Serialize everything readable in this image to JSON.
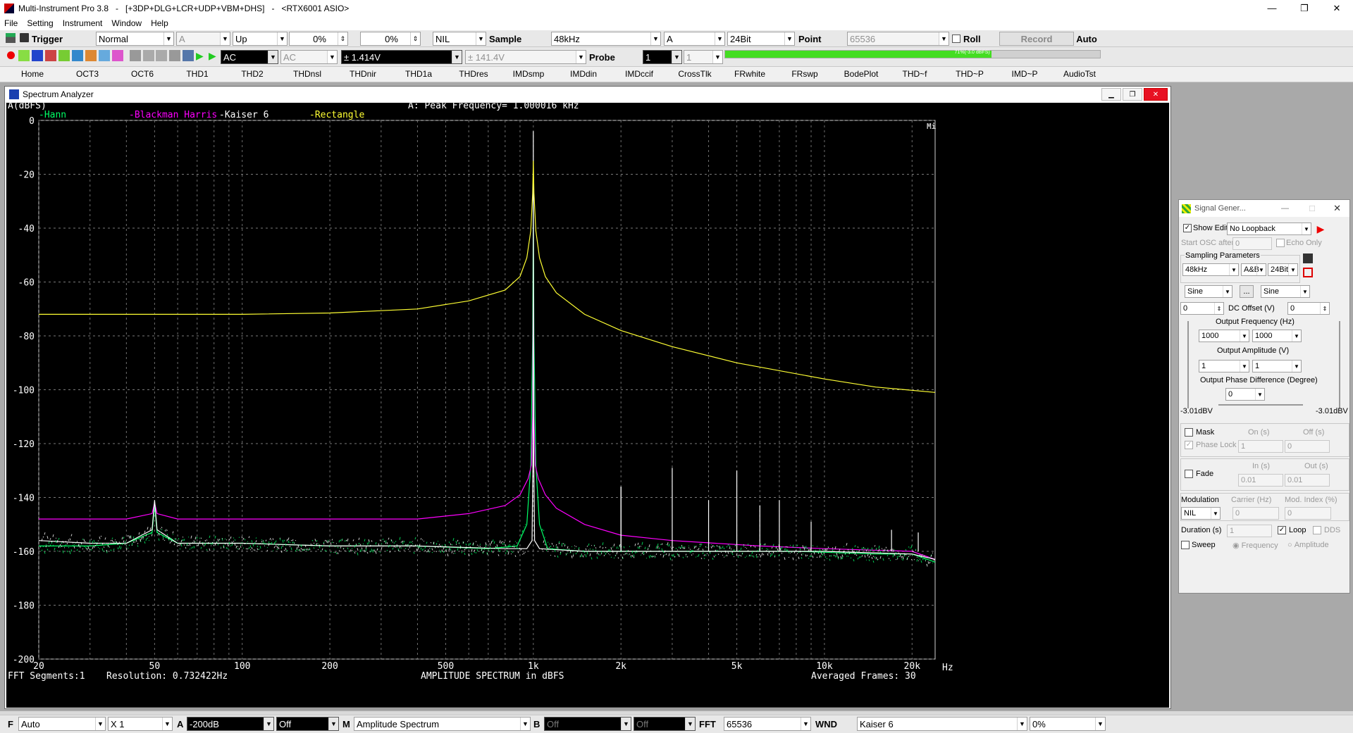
{
  "window": {
    "title": "Multi-Instrument Pro 3.8   -   [+3DP+DLG+LCR+UDP+VBM+DHS]   -   <RTX6001 ASIO>",
    "controls": [
      "—",
      "❐",
      "✕"
    ]
  },
  "menu": [
    "File",
    "Setting",
    "Instrument",
    "Window",
    "Help"
  ],
  "toolbar1": {
    "trigger_label": "Trigger",
    "trigger_mode": "Normal",
    "trigger_channel": "A",
    "trigger_edge": "Up",
    "trigger_level": "0%",
    "pretrigger": "0%",
    "channel_mode": "NIL",
    "sample_label": "Sample",
    "sample_rate": "48kHz",
    "channel": "A",
    "bit_depth": "24Bit",
    "point_label": "Point",
    "points": "65536",
    "roll_label": "Roll",
    "record_label": "Record",
    "auto_label": "Auto"
  },
  "toolbar2": {
    "coupling_a": "AC",
    "coupling_b": "AC",
    "range_a": "± 1.414V",
    "range_b": "± 141.4V",
    "probe_label": "Probe",
    "probe_a": "1",
    "probe_b": "1",
    "level_meter": "71%(-3.0 dBFS)",
    "level_fraction": 0.71
  },
  "tabs": [
    "Home",
    "OCT3",
    "OCT6",
    "THD1",
    "THD2",
    "THDnsl",
    "THDnir",
    "THD1a",
    "THDres",
    "IMDsmp",
    "IMDdin",
    "IMDccif",
    "CrossTlk",
    "FRwhite",
    "FRswp",
    "BodePlot",
    "THD~f",
    "THD~P",
    "IMD~P",
    "AudioTst"
  ],
  "analyzer": {
    "title": "Spectrum Analyzer",
    "ylabel": "A(dBFS)",
    "peak_readout": "A: Peak Frequency= 1.000016 kHz",
    "logo": "Mi",
    "footer_left": "FFT Segments:1",
    "footer_resolution": "Resolution: 0.732422Hz",
    "footer_center": "AMPLITUDE SPECTRUM in dBFS",
    "footer_right": "Averaged Frames: 30",
    "x_unit": "Hz"
  },
  "chart_data": {
    "type": "line",
    "title": "A: Peak Frequency= 1.000016 kHz",
    "xlabel": "AMPLITUDE SPECTRUM in dBFS",
    "ylabel": "A(dBFS)",
    "xscale": "log",
    "xlim": [
      20,
      24000
    ],
    "ylim": [
      -200,
      0
    ],
    "yticks": [
      0,
      -20,
      -40,
      -60,
      -80,
      -100,
      -120,
      -140,
      -160,
      -180,
      -200
    ],
    "xticks": [
      {
        "v": 20,
        "label": "20"
      },
      {
        "v": 50,
        "label": "50"
      },
      {
        "v": 100,
        "label": "100"
      },
      {
        "v": 200,
        "label": "200"
      },
      {
        "v": 500,
        "label": "500"
      },
      {
        "v": 1000,
        "label": "1k"
      },
      {
        "v": 2000,
        "label": "2k"
      },
      {
        "v": 5000,
        "label": "5k"
      },
      {
        "v": 10000,
        "label": "10k"
      },
      {
        "v": 20000,
        "label": "20k"
      }
    ],
    "grid": true,
    "legend_placement": "top",
    "series": [
      {
        "name": "Hann",
        "color": "#00ff66",
        "x": [
          20,
          30,
          40,
          49,
          50,
          51,
          60,
          100,
          200,
          400,
          700,
          880,
          950,
          980,
          995,
          1000,
          1005,
          1020,
          1050,
          1120,
          1500,
          3000,
          8000,
          15000,
          20000,
          24000
        ],
        "y": [
          -158,
          -158,
          -157,
          -153,
          -143,
          -153,
          -157,
          -157,
          -158,
          -158,
          -159,
          -158,
          -150,
          -128,
          -80,
          -32,
          -80,
          -128,
          -150,
          -159,
          -160,
          -160,
          -160,
          -161,
          -161,
          -164
        ]
      },
      {
        "name": "Blackman Harris",
        "color": "#ff00ff",
        "x": [
          20,
          30,
          40,
          49,
          50,
          51,
          60,
          100,
          200,
          400,
          600,
          800,
          900,
          960,
          985,
          995,
          1000,
          1005,
          1015,
          1040,
          1100,
          1200,
          1500,
          2000,
          3000,
          6000,
          10000,
          20000,
          24000
        ],
        "y": [
          -148,
          -148,
          -148,
          -146,
          -142,
          -146,
          -148,
          -148,
          -148,
          -148,
          -146,
          -143,
          -139,
          -133,
          -128,
          -110,
          -55,
          -110,
          -128,
          -133,
          -139,
          -144,
          -150,
          -154,
          -156,
          -158,
          -159,
          -160,
          -163
        ]
      },
      {
        "name": "Kaiser 6",
        "color": "#ffffff",
        "x": [
          20,
          30,
          40,
          49,
          50,
          51,
          60,
          100,
          200,
          400,
          800,
          950,
          990,
          998,
          1000,
          1002,
          1010,
          1050,
          1500,
          1999,
          2000,
          2001,
          3000,
          5000,
          10000,
          20000,
          24000
        ],
        "y": [
          -156,
          -157,
          -157,
          -152,
          -141,
          -152,
          -157,
          -157,
          -158,
          -158,
          -159,
          -159,
          -156,
          -120,
          -4,
          -120,
          -156,
          -159,
          -160,
          -160,
          -136,
          -160,
          -160,
          -160,
          -160,
          -161,
          -163
        ]
      },
      {
        "name": "Rectangle",
        "color": "#ffff33",
        "x": [
          20,
          50,
          100,
          200,
          400,
          600,
          800,
          900,
          950,
          980,
          995,
          1000,
          1005,
          1020,
          1050,
          1100,
          1200,
          1500,
          2000,
          3000,
          5000,
          10000,
          15000,
          24000
        ],
        "y": [
          -72,
          -72,
          -72,
          -71.5,
          -70,
          -67,
          -63,
          -58,
          -51,
          -41,
          -27,
          -15,
          -27,
          -41,
          -51,
          -58,
          -64,
          -72,
          -78,
          -84,
          -90,
          -96,
          -99,
          -101
        ]
      }
    ],
    "harmonics": [
      {
        "x": 2000,
        "y": -136
      },
      {
        "x": 3000,
        "y": -129
      },
      {
        "x": 4000,
        "y": -141
      },
      {
        "x": 5000,
        "y": -130
      },
      {
        "x": 6000,
        "y": -143
      },
      {
        "x": 7000,
        "y": -141
      },
      {
        "x": 9000,
        "y": -149
      },
      {
        "x": 17000,
        "y": -152
      },
      {
        "x": 21000,
        "y": -153
      }
    ]
  },
  "signal_generator": {
    "title": "Signal Gener...",
    "show_editor": "Show Editor",
    "loopback": "No Loopback",
    "start_osc": "Start OSC after (s)",
    "start_osc_val": "0",
    "echo_only": "Echo Only",
    "sampling_params": "Sampling Parameters",
    "rate": "48kHz",
    "channels": "A&B",
    "bits": "24Bit",
    "wave_a": "Sine",
    "wave_b": "Sine",
    "more": "...",
    "dc_a": "0",
    "dc_label": "DC Offset (V)",
    "dc_b": "0",
    "freq_label": "Output Frequency (Hz)",
    "freq_a": "1000",
    "freq_b": "1000",
    "amp_label": "Output Amplitude (V)",
    "amp_a": "1",
    "amp_b": "1",
    "phase_label": "Output Phase Difference (Degree)",
    "phase": "0",
    "dbv_a": "-3.01dBV",
    "dbv_b": "-3.01dBV",
    "mask": "Mask",
    "on_s": "On (s)",
    "off_s": "Off (s)",
    "phase_lock": "Phase Lock",
    "on_val": "1",
    "off_val": "0",
    "fade": "Fade",
    "in_s": "In (s)",
    "out_s": "Out (s)",
    "in_val": "0.01",
    "out_val": "0.01",
    "modulation": "Modulation",
    "carrier": "Carrier (Hz)",
    "mod_index": "Mod. Index (%)",
    "mod_type": "NIL",
    "carrier_val": "0",
    "mod_index_val": "0",
    "duration": "Duration (s)",
    "duration_val": "1",
    "loop": "Loop",
    "dds": "DDS",
    "sweep": "Sweep",
    "sweep_freq": "Frequency",
    "sweep_amp": "Amplitude"
  },
  "bottombar": {
    "f_label": "F",
    "f_mode": "Auto",
    "zoom": "X 1",
    "a_label": "A",
    "a_range": "-200dB",
    "a_off": "Off",
    "m_label": "M",
    "m_mode": "Amplitude Spectrum",
    "b_label": "B",
    "b_off1": "Off",
    "b_off2": "Off",
    "fft_label": "FFT",
    "fft_size": "65536",
    "wnd_label": "WND",
    "window": "Kaiser 6",
    "overlap": "0%"
  }
}
